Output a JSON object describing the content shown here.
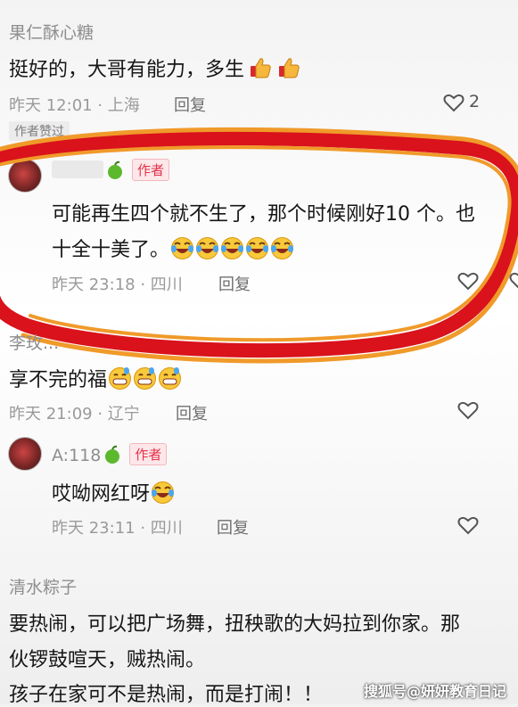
{
  "comments": [
    {
      "username": "果仁酥心糖",
      "text": "挺好的，大哥有能力，多生",
      "time": "昨天 12:01 · 上海",
      "reply": "回复",
      "likes": "2",
      "tag": "作者赞过"
    },
    {
      "username": "",
      "badge": "作者",
      "text_line1": "可能再生四个就不生了，那个时候刚好10 个。也",
      "text_line2": "十全十美了。",
      "time": "昨天 23:18 · 四川",
      "reply": "回复"
    },
    {
      "username": "李玫...",
      "text": "享不完的福",
      "time": "昨天 21:09 · 辽宁",
      "reply": "回复"
    },
    {
      "username": "A:118",
      "badge": "作者",
      "text": "哎呦网红呀",
      "time": "昨天 23:11 · 四川",
      "reply": "回复"
    },
    {
      "username": "清水粽子",
      "text_line1": "要热闹，可以把广场舞，扭秧歌的大妈拉到你家。那",
      "text_line2": "伙锣鼓喧天，贼热闹。",
      "text_line3": "孩子在家可不是热闹，而是打闹！！"
    }
  ],
  "watermark": "搜狐号@妍妍教育日记",
  "colors": {
    "highlight_red": "#d9121b",
    "highlight_orange": "#f09a2a",
    "badge_red": "#e2324a"
  }
}
